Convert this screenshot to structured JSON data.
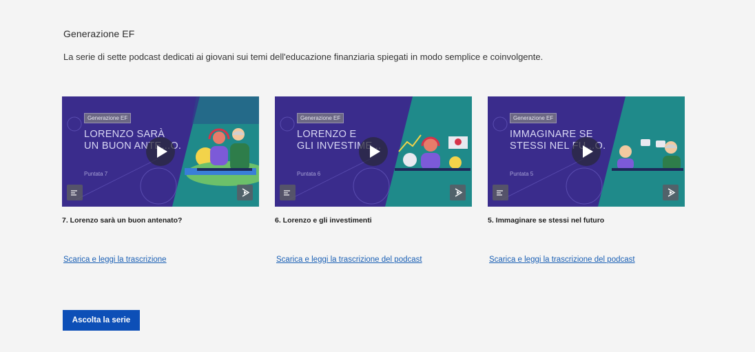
{
  "section": {
    "title": "Generazione EF",
    "description": "La serie di sette podcast dedicati ai giovani sui temi dell'educazione finanziaria spiegati in modo semplice e coinvolgente."
  },
  "cards": [
    {
      "tag": "Generazione EF",
      "thumb_title": "LORENZO SARÀ\nUN BUON ANTE...O.",
      "episode": "Puntata 7",
      "caption": "7. Lorenzo sarà un buon antenato?",
      "link": "Scarica e leggi la trascrizione"
    },
    {
      "tag": "Generazione EF",
      "thumb_title": "LORENZO E\nGLI INVESTIME...",
      "episode": "Puntata 6",
      "caption": "6. Lorenzo e gli investimenti",
      "link": "Scarica e leggi la trascrizione del podcast"
    },
    {
      "tag": "Generazione EF",
      "thumb_title": "IMMAGINARE SE\nSTESSI NEL FU...O.",
      "episode": "Puntata 5",
      "caption": "5. Immaginare se stessi nel futuro",
      "link": "Scarica e leggi la trascrizione del podcast"
    }
  ],
  "cta": {
    "label": "Ascolta la serie"
  },
  "icons": {
    "play": "play-icon",
    "transcript": "text-lines-icon",
    "share": "share-play-icon"
  },
  "colors": {
    "thumb_purple": "#3a2c8c",
    "thumb_teal": "#1e8a8a",
    "link": "#1a5fb4",
    "button": "#0d4fb7"
  }
}
